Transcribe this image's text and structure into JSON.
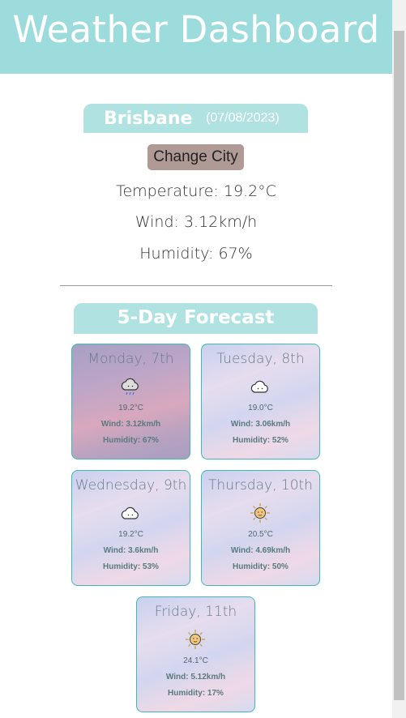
{
  "app": {
    "title": "Weather Dashboard"
  },
  "current": {
    "city": "Brisbane",
    "date": "(07/08/2023)",
    "change_label": "Change City",
    "temperature": "Temperature: 19.2°C",
    "wind": "Wind: 3.12km/h",
    "humidity": "Humidity: 67%"
  },
  "forecast": {
    "title": "5-Day Forecast",
    "days": [
      {
        "day": "Monday, 7th",
        "icon": "rain-cloud-icon",
        "temp": "19.2°C",
        "wind": "Wind: 3.12km/h",
        "humidity": "Humidity: 67%"
      },
      {
        "day": "Tuesday, 8th",
        "icon": "cloud-icon",
        "temp": "19.0°C",
        "wind": "Wind: 3.06km/h",
        "humidity": "Humidity: 52%"
      },
      {
        "day": "Wednesday, 9th",
        "icon": "cloud-icon",
        "temp": "19.2°C",
        "wind": "Wind: 3.6km/h",
        "humidity": "Humidity: 53%"
      },
      {
        "day": "Thursday, 10th",
        "icon": "sun-icon",
        "temp": "20.5°C",
        "wind": "Wind: 4.69km/h",
        "humidity": "Humidity: 50%"
      },
      {
        "day": "Friday, 11th",
        "icon": "sun-icon",
        "temp": "24.1°C",
        "wind": "Wind: 5.12km/h",
        "humidity": "Humidity: 17%"
      }
    ]
  },
  "colors": {
    "header": "#9ddcdc",
    "banner": "#b1e2e2",
    "button": "#b09a96",
    "card_border": "#40b8b8"
  }
}
